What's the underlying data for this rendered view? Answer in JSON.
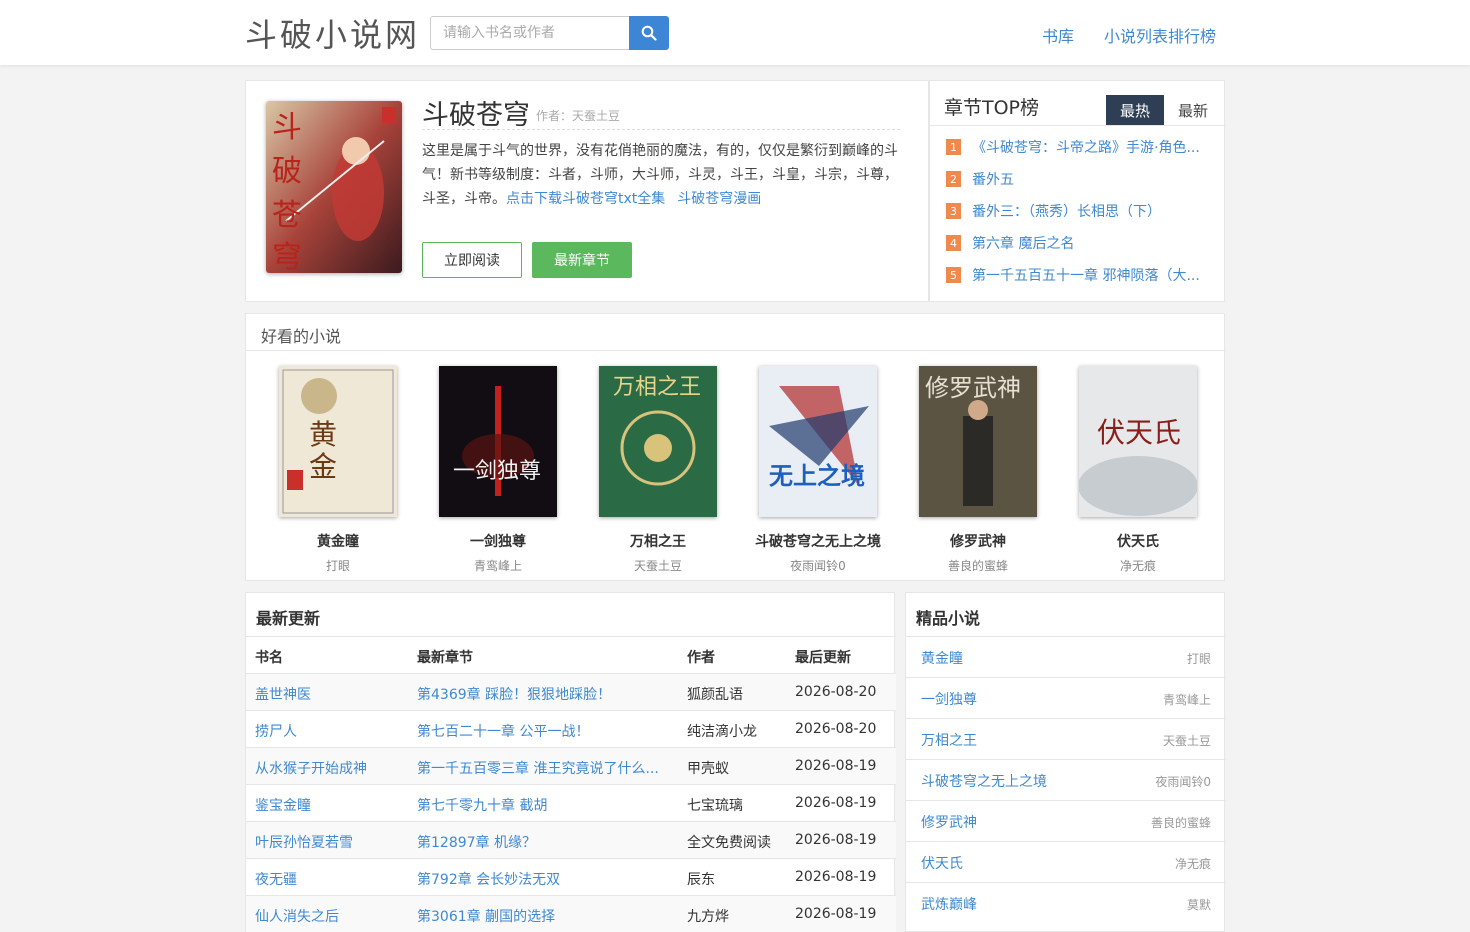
{
  "header": {
    "logo": "斗破小说网",
    "search_placeholder": "请输入书名或作者",
    "nav": [
      "书库",
      "小说列表排行榜"
    ]
  },
  "book": {
    "title": "斗破苍穹",
    "author": "作者：天蚕土豆",
    "description": "这里是属于斗气的世界，没有花俏艳丽的魔法，有的，仅仅是繁衍到巅峰的斗气！新书等级制度：斗者，斗师，大斗师，斗灵，斗王，斗皇，斗宗，斗尊，斗圣，斗帝。",
    "link_download": "点击下载斗破苍穹txt全集",
    "link_comic": "斗破苍穹漫画",
    "btn_read": "立即阅读",
    "btn_latest": "最新章节"
  },
  "top_list": {
    "title": "章节TOP榜",
    "tabs": [
      "最热",
      "最新"
    ],
    "items": [
      {
        "rank": "1",
        "title": "《斗破苍穹：斗帝之路》手游·角色..."
      },
      {
        "rank": "2",
        "title": "番外五"
      },
      {
        "rank": "3",
        "title": "番外三：（燕秀）长相思（下）"
      },
      {
        "rank": "4",
        "title": "第六章 魔后之名"
      },
      {
        "rank": "5",
        "title": "第一千五百五十一章 邪神陨落（大..."
      }
    ]
  },
  "recommended": {
    "heading": "好看的小说",
    "items": [
      {
        "name": "黄金瞳",
        "author": "打眼"
      },
      {
        "name": "一剑独尊",
        "author": "青鸾峰上"
      },
      {
        "name": "万相之王",
        "author": "天蚕土豆"
      },
      {
        "name": "斗破苍穹之无上之境",
        "author": "夜雨闻铃0"
      },
      {
        "name": "修罗武神",
        "author": "善良的蜜蜂"
      },
      {
        "name": "伏天氏",
        "author": "净无痕"
      }
    ]
  },
  "updates": {
    "heading": "最新更新",
    "columns": [
      "书名",
      "最新章节",
      "作者",
      "最后更新"
    ],
    "rows": [
      {
        "book": "盖世神医",
        "chapter": "第4369章 踩脸！狠狠地踩脸！",
        "author": "狐颜乱语",
        "date": "2026-08-20"
      },
      {
        "book": "捞尸人",
        "chapter": "第七百二十一章 公平一战！",
        "author": "纯洁滴小龙",
        "date": "2026-08-20"
      },
      {
        "book": "从水猴子开始成神",
        "chapter": "第一千五百零三章 淮王究竟说了什么...",
        "author": "甲壳蚁",
        "date": "2026-08-19"
      },
      {
        "book": "鉴宝金瞳",
        "chapter": "第七千零九十章 截胡",
        "author": "七宝琉璃",
        "date": "2026-08-19"
      },
      {
        "book": "叶辰孙怡夏若雪",
        "chapter": "第12897章 机缘？",
        "author": "全文免费阅读",
        "date": "2026-08-19"
      },
      {
        "book": "夜无疆",
        "chapter": "第792章 会长妙法无双",
        "author": "辰东",
        "date": "2026-08-19"
      },
      {
        "book": "仙人消失之后",
        "chapter": "第3061章 蒯国的选择",
        "author": "九方烨",
        "date": "2026-08-19"
      }
    ]
  },
  "premium": {
    "heading": "精品小说",
    "items": [
      {
        "name": "黄金瞳",
        "author": "打眼"
      },
      {
        "name": "一剑独尊",
        "author": "青鸾峰上"
      },
      {
        "name": "万相之王",
        "author": "天蚕土豆"
      },
      {
        "name": "斗破苍穹之无上之境",
        "author": "夜雨闻铃0"
      },
      {
        "name": "修罗武神",
        "author": "善良的蜜蜂"
      },
      {
        "name": "伏天氏",
        "author": "净无痕"
      },
      {
        "name": "武炼巅峰",
        "author": "莫默"
      }
    ]
  },
  "colors": {
    "link": "#3f89d1",
    "search_button": "#3d86d6",
    "tab_active": "#2e3f55",
    "green": "#5cb85c",
    "rank": "#f0894c"
  }
}
